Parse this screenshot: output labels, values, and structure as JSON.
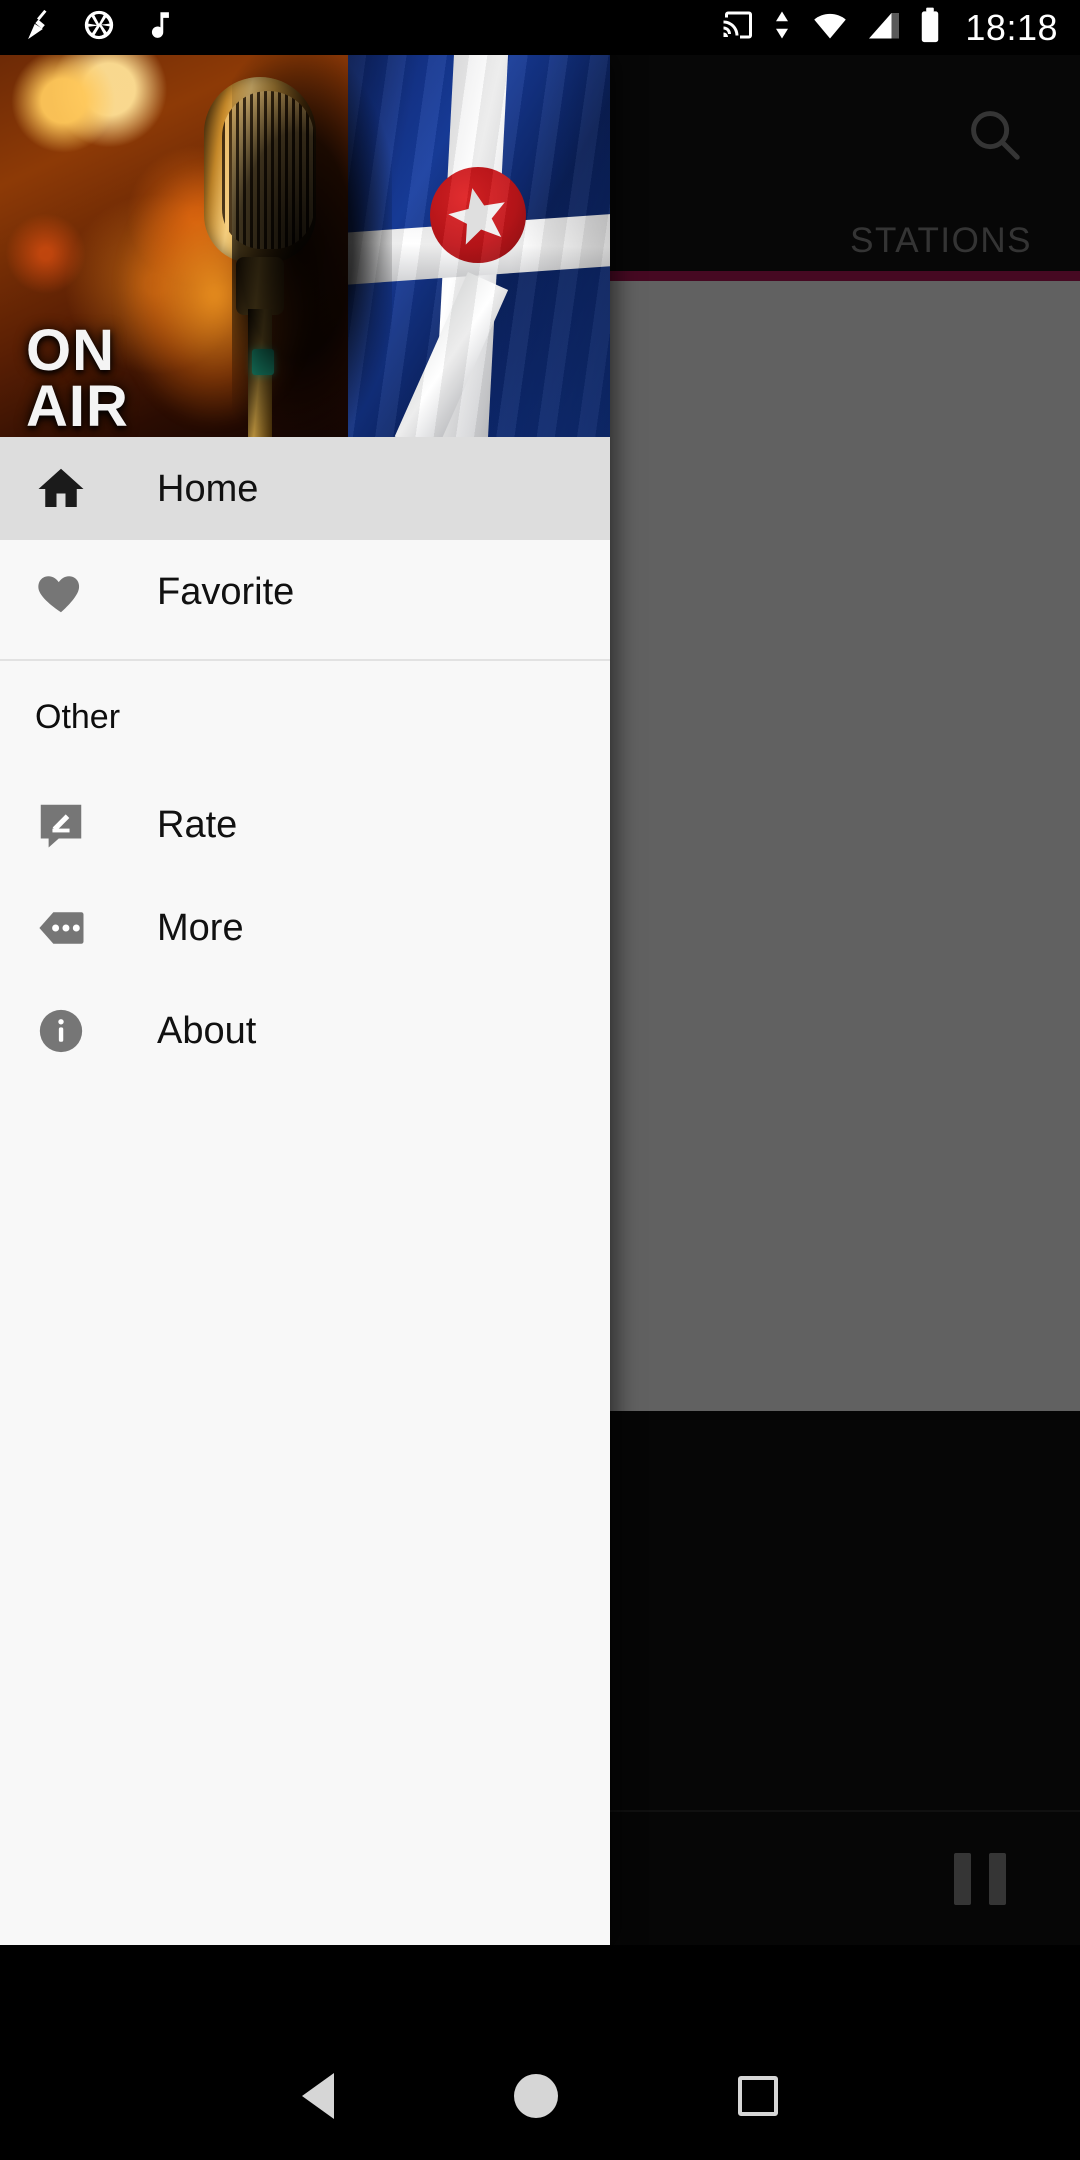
{
  "status_bar": {
    "time": "18:18",
    "left_icons": [
      "broom-icon",
      "camera-aperture-icon",
      "music-note-icon"
    ],
    "right_icons": [
      "cast-icon",
      "data-transfer-icon",
      "wifi-icon",
      "cellular-signal-icon",
      "battery-icon"
    ],
    "background": "#000000"
  },
  "app_behind": {
    "toolbar": {
      "search_icon": "search-icon"
    },
    "tabs": [
      {
        "label": "STATIONS",
        "active": false
      }
    ],
    "tab_indicator_color": "#b8185a",
    "player": {
      "control_icon": "pause-icon"
    }
  },
  "drawer": {
    "header": {
      "on_air_line1": "ON",
      "on_air_line2": "AIR",
      "image_name": "radio-microphone-indianapolis-flag-banner"
    },
    "items": [
      {
        "label": "Home",
        "icon": "home-icon",
        "selected": true
      },
      {
        "label": "Favorite",
        "icon": "heart-icon",
        "selected": false
      }
    ],
    "section_title": "Other",
    "other_items": [
      {
        "label": "Rate",
        "icon": "rate-review-icon",
        "selected": false
      },
      {
        "label": "More",
        "icon": "more-apps-icon",
        "selected": false
      },
      {
        "label": "About",
        "icon": "info-icon",
        "selected": false
      }
    ],
    "selected_row_color": "#dddddd",
    "background": "#f8f8f8"
  },
  "nav_bar": {
    "buttons": [
      {
        "name": "back-button",
        "icon": "triangle-back-icon"
      },
      {
        "name": "home-button",
        "icon": "circle-home-icon"
      },
      {
        "name": "recents-button",
        "icon": "square-recents-icon"
      }
    ]
  }
}
